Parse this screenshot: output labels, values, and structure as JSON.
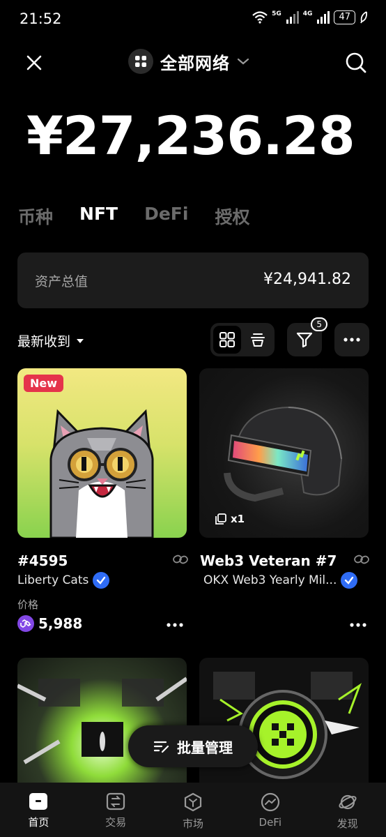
{
  "status_bar": {
    "time": "21:52",
    "net1": "5G",
    "net2": "4G",
    "battery": "47"
  },
  "header": {
    "network_title": "全部网络"
  },
  "balance": "¥27,236.28",
  "tabs": [
    "币种",
    "NFT",
    "DeFi",
    "授权"
  ],
  "total": {
    "label": "资产总值",
    "value": "¥24,941.82"
  },
  "sort": {
    "label": "最新收到"
  },
  "filter": {
    "badge": "5"
  },
  "nfts": [
    {
      "badge": "New",
      "name": "#4595",
      "collection": "Liberty Cats",
      "price_label": "价格",
      "price": "5,988"
    },
    {
      "name": "Web3 Veteran #7",
      "collection": "OKX Web3 Yearly Mil...",
      "quantity": "x1"
    }
  ],
  "batch_button": "批量管理",
  "bottom_nav": [
    "首页",
    "交易",
    "市场",
    "DeFi",
    "发现"
  ],
  "colors": {
    "background": "#000000",
    "card": "#1c1c1c",
    "verified": "#2f6cf5",
    "new_badge": "#e5334b",
    "polygon": "#8247e5"
  }
}
